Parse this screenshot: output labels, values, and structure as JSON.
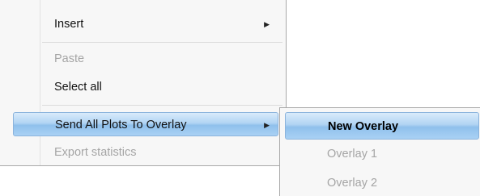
{
  "menu": {
    "items": [
      {
        "label": "Insert",
        "has_submenu": true,
        "enabled": true
      },
      {
        "label": "Paste",
        "enabled": false
      },
      {
        "label": "Select all",
        "enabled": true
      },
      {
        "label": "Send All Plots To Overlay",
        "has_submenu": true,
        "enabled": true,
        "highlighted": true
      },
      {
        "label": "Export statistics",
        "enabled": false
      }
    ],
    "submenu_arrow_glyph": "▶"
  },
  "submenu": {
    "items": [
      {
        "label": "New Overlay",
        "enabled": true,
        "highlighted": true
      },
      {
        "label": "Overlay 1",
        "enabled": false
      },
      {
        "label": "Overlay 2",
        "enabled": false
      }
    ]
  },
  "colors": {
    "highlight": "#b1d4f3",
    "disabled_text": "#a5a5a5",
    "menu_background": "#f7f7f7"
  }
}
